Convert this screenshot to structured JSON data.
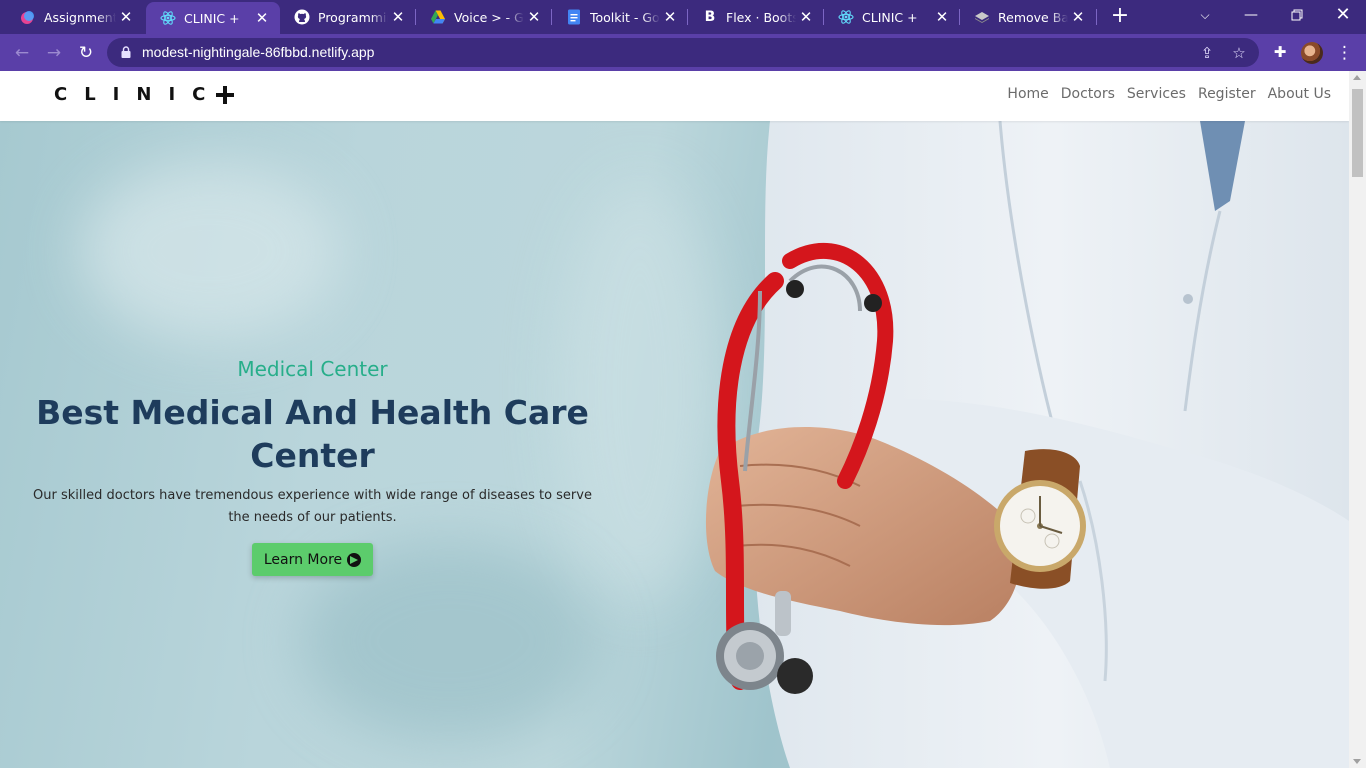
{
  "browser": {
    "tabs": [
      {
        "title": "Assignment -",
        "icon": "assignment-app-icon"
      },
      {
        "title": "CLINIC +",
        "icon": "react-icon",
        "active": true
      },
      {
        "title": "Programming",
        "icon": "github-icon"
      },
      {
        "title": "Voice > - Goo",
        "icon": "google-drive-icon"
      },
      {
        "title": "Toolkit - Goo",
        "icon": "google-docs-icon"
      },
      {
        "title": "Flex · Bootstra",
        "icon": "bootstrap-icon"
      },
      {
        "title": "CLINIC +",
        "icon": "react-icon"
      },
      {
        "title": "Remove Back",
        "icon": "remove-bg-icon"
      }
    ],
    "url": "modest-nightingale-86fbbd.netlify.app"
  },
  "site": {
    "brand": "CLINIC",
    "nav": [
      "Home",
      "Doctors",
      "Services",
      "Register",
      "About Us"
    ]
  },
  "hero": {
    "eyebrow": "Medical Center",
    "title": "Best Medical And Health Care Center",
    "description": "Our skilled doctors have tremendous experience with wide range of diseases to serve the needs of our patients.",
    "button": "Learn More"
  },
  "colors": {
    "chrome_dark": "#3c2a7e",
    "chrome_toolbar": "#5a3fa8",
    "eyebrow": "#27ae8a",
    "title": "#1e3c5c",
    "button": "#5ccc6c"
  }
}
